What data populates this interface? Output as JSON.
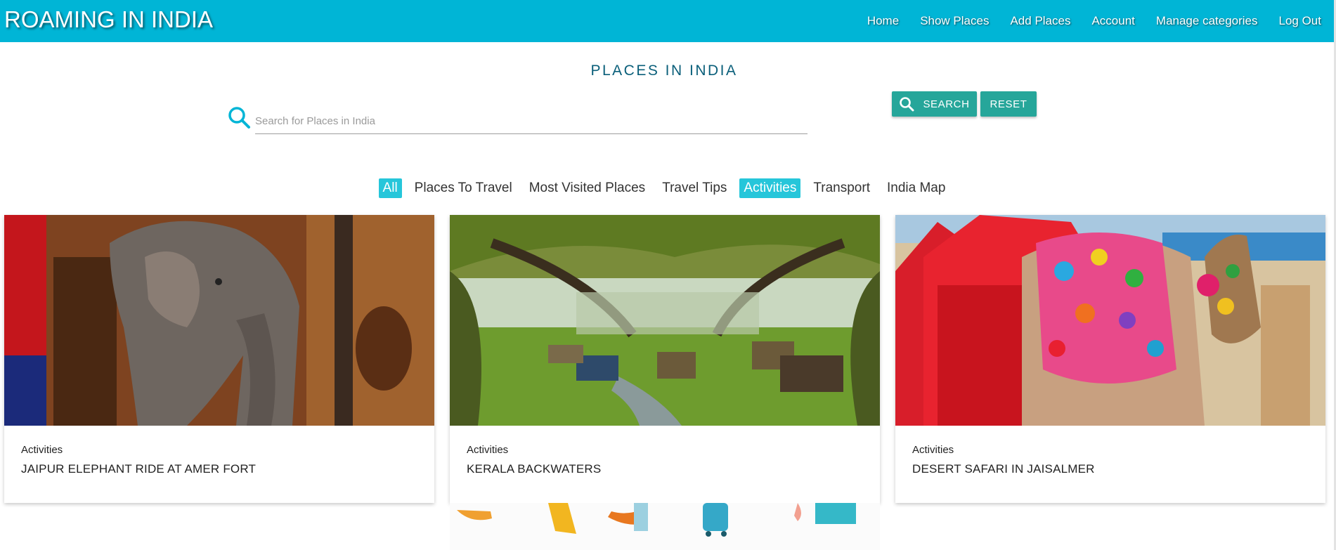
{
  "app": {
    "brand": "ROAMING IN INDIA",
    "accent_color": "#00b5d6",
    "button_color": "#26a69a",
    "tab_active_color": "#26c6da"
  },
  "nav": {
    "items": [
      {
        "label": "Home"
      },
      {
        "label": "Show Places"
      },
      {
        "label": "Add Places"
      },
      {
        "label": "Account"
      },
      {
        "label": "Manage categories"
      },
      {
        "label": "Log Out"
      }
    ]
  },
  "page": {
    "title": "PLACES IN INDIA"
  },
  "search": {
    "icon": "search-icon",
    "placeholder": "Search for Places in India",
    "value": "",
    "search_button": "SEARCH",
    "reset_button": "RESET"
  },
  "tabs": {
    "items": [
      {
        "label": "All",
        "active": true
      },
      {
        "label": "Places To Travel",
        "active": false
      },
      {
        "label": "Most Visited Places",
        "active": false
      },
      {
        "label": "Travel Tips",
        "active": false
      },
      {
        "label": "Activities",
        "active": true
      },
      {
        "label": "Transport",
        "active": false
      },
      {
        "label": "India Map",
        "active": false
      }
    ]
  },
  "cards": [
    {
      "category": "Activities",
      "title": "JAIPUR ELEPHANT RIDE AT AMER FORT",
      "image": "elephant-photo"
    },
    {
      "category": "Activities",
      "title": "KERALA BACKWATERS",
      "image": "backwaters-photo"
    },
    {
      "category": "Activities",
      "title": "DESERT SAFARI IN JAISALMER",
      "image": "camel-photo"
    }
  ]
}
